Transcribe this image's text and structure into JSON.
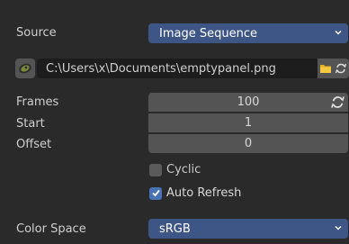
{
  "source": {
    "label": "Source",
    "value": "Image Sequence"
  },
  "file": {
    "path": "C:\\Users\\x\\Documents\\emptypanel.png"
  },
  "frames": {
    "label": "Frames",
    "value": "100"
  },
  "start": {
    "label": "Start",
    "value": "1"
  },
  "offset": {
    "label": "Offset",
    "value": "0"
  },
  "cyclic": {
    "label": "Cyclic",
    "checked": false
  },
  "auto_refresh": {
    "label": "Auto Refresh",
    "checked": true
  },
  "color_space": {
    "label": "Color Space",
    "value": "sRGB"
  },
  "colors": {
    "accent": "#3e5686",
    "checkbox_on": "#4772b3",
    "folder": "#e8b01e"
  },
  "icons": [
    "image-icon",
    "folder-icon",
    "reload-icon",
    "chevron-down-icon",
    "checkmark-icon"
  ]
}
